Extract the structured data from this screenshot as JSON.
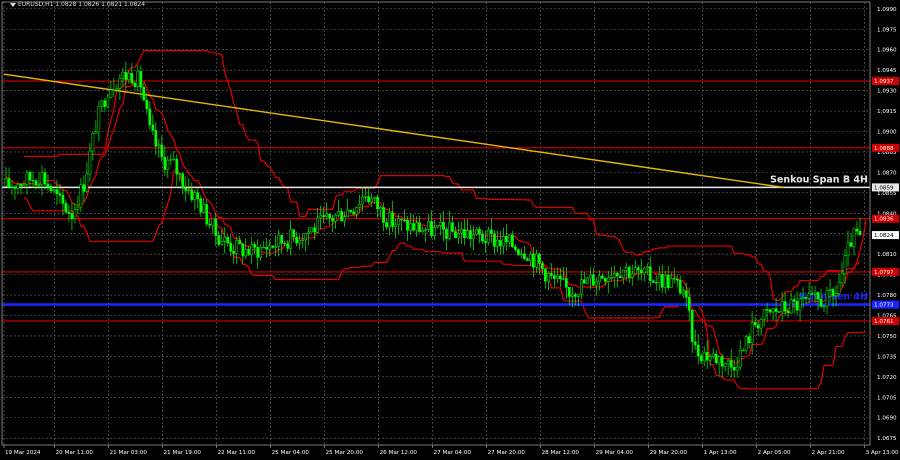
{
  "window": {
    "header_text": "EURUSD,H1  1.0828 1.0826 1.0821 1.0824"
  },
  "colors": {
    "background": "#000000",
    "grid": "#6a6a6a",
    "axis_text": "#ffffff",
    "candle": "#00ff00",
    "ichimoku_band": "#e00000",
    "level_line": "#d00000",
    "level_tag": "#d00000",
    "trend_line": "#e6b800",
    "senkou_line": "#e8e8e8",
    "kijun_line": "#1a24ff",
    "current_tag": "#ffffff"
  },
  "chart_data": {
    "type": "candlestick",
    "symbol": "EURUSD",
    "timeframe": "H1",
    "y_axis": {
      "range": [
        1.067,
        1.0995
      ],
      "ticks": [
        "1.0990",
        "1.0975",
        "1.0960",
        "1.0945",
        "1.0930",
        "1.0915",
        "1.0900",
        "1.0885",
        "1.0870",
        "1.0855",
        "1.0840",
        "1.0825",
        "1.0810",
        "1.0795",
        "1.0780",
        "1.0765",
        "1.0750",
        "1.0735",
        "1.0720",
        "1.0705",
        "1.0690",
        "1.0675"
      ]
    },
    "x_axis": {
      "bar_count": 140,
      "ticks": [
        {
          "label": "19 Mar 2024",
          "bar": 0
        },
        {
          "label": "20 Mar 11:00",
          "bar": 15
        },
        {
          "label": "21 Mar 03:00",
          "bar": 31
        },
        {
          "label": "21 Mar 19:00",
          "bar": 47
        },
        {
          "label": "22 Mar 11:00",
          "bar": 63
        },
        {
          "label": "25 Mar 04:00",
          "bar": 79
        },
        {
          "label": "25 Mar 20:00",
          "bar": 95
        },
        {
          "label": "26 Mar 12:00",
          "bar": 111
        },
        {
          "label": "27 Mar 04:00",
          "bar": 127
        },
        {
          "label": "27 Mar 20:00",
          "bar": 143
        },
        {
          "label": "28 Mar 12:00",
          "bar": 159
        },
        {
          "label": "29 Mar 04:00",
          "bar": 175
        },
        {
          "label": "29 Mar 20:00",
          "bar": 191
        },
        {
          "label": "1 Apr 13:00",
          "bar": 207
        },
        {
          "label": "2 Apr 05:00",
          "bar": 223
        },
        {
          "label": "2 Apr 21:00",
          "bar": 239
        },
        {
          "label": "3 Apr 13:00",
          "bar": 255
        }
      ],
      "bars_total_span": 256
    },
    "price_path": [
      [
        0,
        1.086
      ],
      [
        12,
        1.0868
      ],
      [
        18,
        1.0848
      ],
      [
        22,
        1.084
      ],
      [
        26,
        1.0862
      ],
      [
        30,
        1.0905
      ],
      [
        34,
        1.0932
      ],
      [
        38,
        1.094
      ],
      [
        42,
        1.0942
      ],
      [
        45,
        1.0935
      ],
      [
        48,
        1.09
      ],
      [
        52,
        1.088
      ],
      [
        56,
        1.0875
      ],
      [
        60,
        1.086
      ],
      [
        64,
        1.085
      ],
      [
        70,
        1.0825
      ],
      [
        76,
        1.0815
      ],
      [
        82,
        1.0812
      ],
      [
        90,
        1.0818
      ],
      [
        100,
        1.0826
      ],
      [
        110,
        1.0838
      ],
      [
        116,
        1.0845
      ],
      [
        120,
        1.0855
      ],
      [
        124,
        1.0845
      ],
      [
        128,
        1.0834
      ],
      [
        136,
        1.083
      ],
      [
        144,
        1.0827
      ],
      [
        152,
        1.0826
      ],
      [
        160,
        1.0822
      ],
      [
        168,
        1.0818
      ],
      [
        174,
        1.0812
      ],
      [
        182,
        1.0792
      ],
      [
        188,
        1.0783
      ],
      [
        194,
        1.079
      ],
      [
        200,
        1.0796
      ],
      [
        206,
        1.08
      ],
      [
        212,
        1.0795
      ],
      [
        218,
        1.0792
      ],
      [
        222,
        1.079
      ],
      [
        226,
        1.0784
      ],
      [
        230,
        1.074
      ],
      [
        234,
        1.0736
      ],
      [
        238,
        1.0734
      ],
      [
        242,
        1.0728
      ],
      [
        246,
        1.074
      ],
      [
        250,
        1.076
      ],
      [
        256,
        1.0768
      ],
      [
        262,
        1.0772
      ],
      [
        268,
        1.0775
      ],
      [
        272,
        1.0776
      ],
      [
        276,
        1.0778
      ],
      [
        279,
        1.0795
      ],
      [
        282,
        1.082
      ],
      [
        285,
        1.0826
      ]
    ],
    "path_bars": 285,
    "horizontal_levels": [
      {
        "name": "level-1.0937",
        "price": 1.0937,
        "style": "red",
        "tag": "1.0937"
      },
      {
        "name": "level-1.0888",
        "price": 1.0888,
        "style": "red",
        "tag": "1.0888"
      },
      {
        "name": "senkou-span-b-4h",
        "price": 1.0859,
        "style": "senkou",
        "tag": "1.0859",
        "text": "Senkou Span B 4H"
      },
      {
        "name": "level-1.0836",
        "price": 1.0836,
        "style": "red",
        "tag": "1.0836"
      },
      {
        "name": "level-1.0797",
        "price": 1.0797,
        "style": "red",
        "tag": "1.0797"
      },
      {
        "name": "kijun-sen-4h",
        "price": 1.0773,
        "style": "kijun",
        "tag": "1.0773",
        "text": "Kijun-sen 4H"
      },
      {
        "name": "level-1.0761",
        "price": 1.0761,
        "style": "red",
        "tag": "1.0761"
      }
    ],
    "trend_line": {
      "from_bar": 0,
      "from_price": 1.0942,
      "to_bar": 225,
      "to_price": 1.0859
    },
    "current_price": {
      "price": 1.0824,
      "tag": "1.0824"
    }
  }
}
